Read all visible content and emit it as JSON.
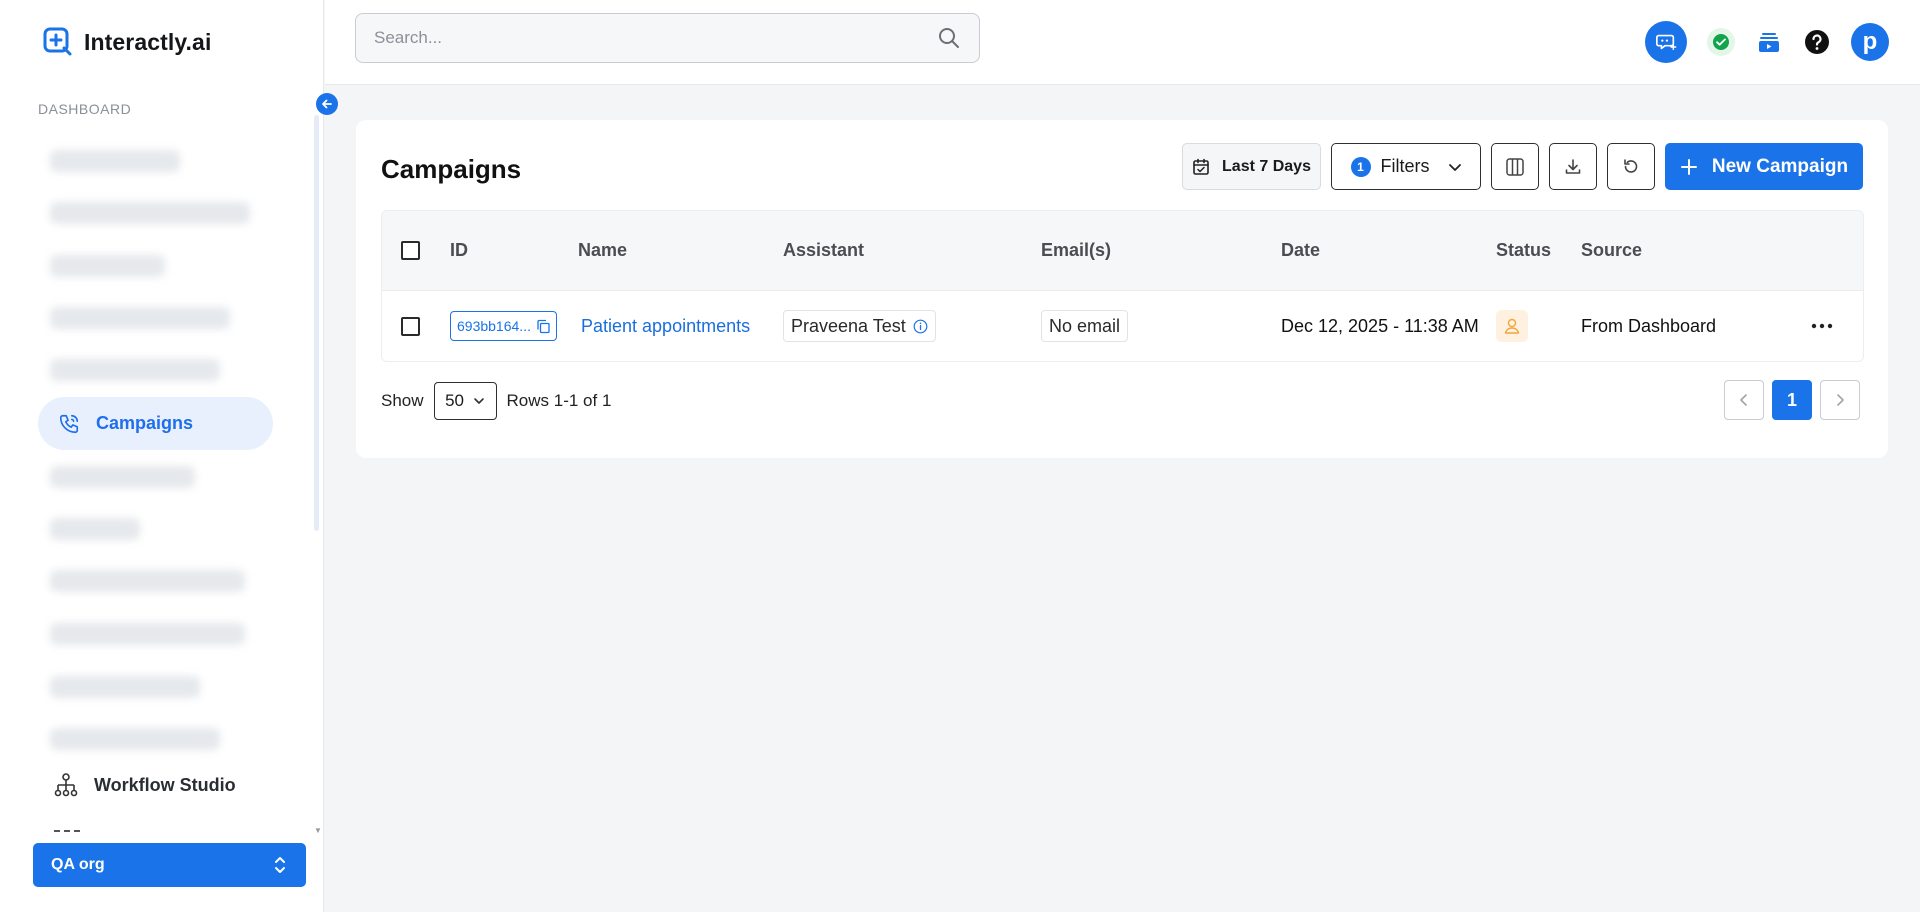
{
  "app": {
    "name": "Interactly.ai"
  },
  "sidebar": {
    "section_label": "DASHBOARD",
    "active_item": {
      "label": "Campaigns",
      "icon": "phone-icon"
    },
    "workflow_item": {
      "label": "Workflow Studio",
      "icon": "workflow-icon"
    },
    "org_selector": {
      "label": "QA org"
    }
  },
  "search": {
    "placeholder": "Search..."
  },
  "header": {
    "avatar_letter": "p"
  },
  "page": {
    "title": "Campaigns"
  },
  "toolbar": {
    "date_range_label": "Last 7 Days",
    "filters_label": "Filters",
    "filters_count": "1",
    "new_campaign_label": "New Campaign"
  },
  "table": {
    "columns": [
      "ID",
      "Name",
      "Assistant",
      "Email(s)",
      "Date",
      "Status",
      "Source"
    ],
    "rows": [
      {
        "id": "693bb164...",
        "name": "Patient appointments",
        "assistant": "Praveena Test",
        "email": "No email",
        "date": "Dec 12, 2025 - 11:38 AM",
        "source": "From Dashboard"
      }
    ]
  },
  "pagination": {
    "show_label": "Show",
    "page_size": "50",
    "rows_label": "Rows 1-1 of 1",
    "current_page": "1"
  },
  "colors": {
    "accent": "#1a73e8",
    "status_pending": "#fff1e0"
  }
}
